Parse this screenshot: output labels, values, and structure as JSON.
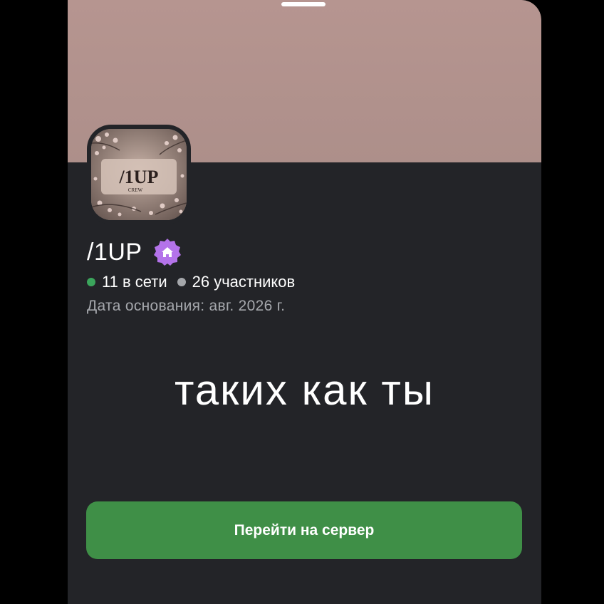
{
  "server": {
    "name": "/1UP",
    "badge_icon": "home-icon",
    "badge_color": "#b473ea",
    "online_count": "11 в сети",
    "member_count": "26 участников",
    "founded": "Дата основания: авг. 2026 г.",
    "avatar_logo_text": "/1UP",
    "avatar_logo_subtext": "CREW"
  },
  "overlay": {
    "caption": "таких как ты"
  },
  "actions": {
    "go_to_server_label": "Перейти на сервер"
  },
  "colors": {
    "banner": "#b69590",
    "card_background": "#232428",
    "online_dot": "#3ba55c",
    "members_dot": "#a5a7ab",
    "button": "#3f8f47"
  }
}
